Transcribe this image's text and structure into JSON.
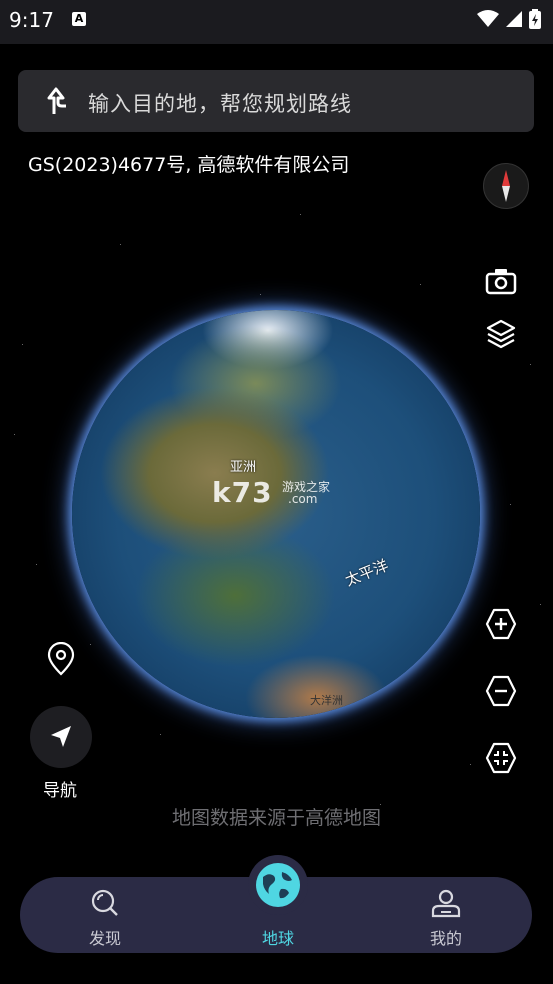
{
  "status_bar": {
    "time": "9:17",
    "badge": "A"
  },
  "search": {
    "placeholder": "输入目的地，帮您规划路线"
  },
  "copyright": "GS(2023)4677号, 高德软件有限公司",
  "globe": {
    "labels": {
      "asia": "亚洲",
      "pacific": "太平洋",
      "antarctica": "大洋洲"
    },
    "watermark": {
      "logo": "k73",
      "cn": "游戏之家",
      "domain": ".com"
    }
  },
  "navigation": {
    "label": "导航"
  },
  "source": "地图数据来源于高德地图",
  "bottom_nav": {
    "items": [
      {
        "label": "发现"
      },
      {
        "label": "地球"
      },
      {
        "label": "我的"
      }
    ],
    "active_color": "#4fd6e2"
  }
}
